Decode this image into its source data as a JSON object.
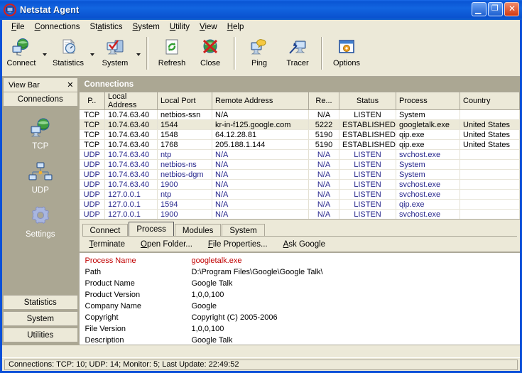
{
  "window": {
    "title": "Netstat Agent",
    "app_icon": "netstat-agent-icon",
    "minimize_glyph": "_",
    "maximize_glyph": "❐",
    "close_glyph": "✕"
  },
  "menu": [
    {
      "label": "File",
      "accel": "F"
    },
    {
      "label": "Connections",
      "accel": "C"
    },
    {
      "label": "Statistics",
      "accel": "a"
    },
    {
      "label": "System",
      "accel": "S"
    },
    {
      "label": "Utility",
      "accel": "U"
    },
    {
      "label": "View",
      "accel": "V"
    },
    {
      "label": "Help",
      "accel": "H"
    }
  ],
  "toolbar": [
    {
      "label": "Connect",
      "icon": "globe-connect-icon",
      "dropdown": true
    },
    {
      "label": "Statistics",
      "icon": "document-clock-icon",
      "dropdown": true
    },
    {
      "label": "System",
      "icon": "system-check-icon",
      "dropdown": true
    },
    {
      "label": "Refresh",
      "icon": "refresh-icon",
      "dropdown": false
    },
    {
      "label": "Close",
      "icon": "close-connection-icon",
      "dropdown": false
    },
    {
      "label": "Ping",
      "icon": "ping-icon",
      "dropdown": false
    },
    {
      "label": "Tracer",
      "icon": "tracer-icon",
      "dropdown": false
    },
    {
      "label": "Options",
      "icon": "options-icon",
      "dropdown": false
    }
  ],
  "viewbar": {
    "title": "View Bar",
    "close_glyph": "✕",
    "group_label": "Connections",
    "items": [
      {
        "label": "TCP",
        "icon": "tcp-globe-icon"
      },
      {
        "label": "UDP",
        "icon": "udp-network-icon"
      },
      {
        "label": "Settings",
        "icon": "gear-icon"
      }
    ],
    "buttons": [
      "Statistics",
      "System",
      "Utilities"
    ]
  },
  "connections": {
    "panel_title": "Connections",
    "columns": [
      "P..",
      "Local Address",
      "Local Port",
      "Remote Address",
      "Re...",
      "Status",
      "Process",
      "Country"
    ],
    "rows": [
      {
        "proto": "TCP",
        "local_address": "10.74.63.40",
        "local_port": "netbios-ssn",
        "remote_address": "N/A",
        "remote_port": "N/A",
        "status": "LISTEN",
        "process": "System",
        "country": "",
        "selected": false
      },
      {
        "proto": "TCP",
        "local_address": "10.74.63.40",
        "local_port": "1544",
        "remote_address": "kr-in-f125.google.com",
        "remote_port": "5222",
        "status": "ESTABLISHED",
        "process": "googletalk.exe",
        "country": "United States",
        "selected": true
      },
      {
        "proto": "TCP",
        "local_address": "10.74.63.40",
        "local_port": "1548",
        "remote_address": "64.12.28.81",
        "remote_port": "5190",
        "status": "ESTABLISHED",
        "process": "qip.exe",
        "country": "United States",
        "selected": false
      },
      {
        "proto": "TCP",
        "local_address": "10.74.63.40",
        "local_port": "1768",
        "remote_address": "205.188.1.144",
        "remote_port": "5190",
        "status": "ESTABLISHED",
        "process": "qip.exe",
        "country": "United States",
        "selected": false
      },
      {
        "proto": "UDP",
        "local_address": "10.74.63.40",
        "local_port": "ntp",
        "remote_address": "N/A",
        "remote_port": "N/A",
        "status": "LISTEN",
        "process": "svchost.exe",
        "country": "",
        "selected": false
      },
      {
        "proto": "UDP",
        "local_address": "10.74.63.40",
        "local_port": "netbios-ns",
        "remote_address": "N/A",
        "remote_port": "N/A",
        "status": "LISTEN",
        "process": "System",
        "country": "",
        "selected": false
      },
      {
        "proto": "UDP",
        "local_address": "10.74.63.40",
        "local_port": "netbios-dgm",
        "remote_address": "N/A",
        "remote_port": "N/A",
        "status": "LISTEN",
        "process": "System",
        "country": "",
        "selected": false
      },
      {
        "proto": "UDP",
        "local_address": "10.74.63.40",
        "local_port": "1900",
        "remote_address": "N/A",
        "remote_port": "N/A",
        "status": "LISTEN",
        "process": "svchost.exe",
        "country": "",
        "selected": false
      },
      {
        "proto": "UDP",
        "local_address": "127.0.0.1",
        "local_port": "ntp",
        "remote_address": "N/A",
        "remote_port": "N/A",
        "status": "LISTEN",
        "process": "svchost.exe",
        "country": "",
        "selected": false
      },
      {
        "proto": "UDP",
        "local_address": "127.0.0.1",
        "local_port": "1594",
        "remote_address": "N/A",
        "remote_port": "N/A",
        "status": "LISTEN",
        "process": "qip.exe",
        "country": "",
        "selected": false
      },
      {
        "proto": "UDP",
        "local_address": "127.0.0.1",
        "local_port": "1900",
        "remote_address": "N/A",
        "remote_port": "N/A",
        "status": "LISTEN",
        "process": "svchost.exe",
        "country": "",
        "selected": false
      }
    ]
  },
  "details": {
    "tabs": [
      {
        "label": "Connect",
        "active": false
      },
      {
        "label": "Process",
        "active": true
      },
      {
        "label": "Modules",
        "active": false
      },
      {
        "label": "System",
        "active": false
      }
    ],
    "actions": [
      {
        "label": "Terminate",
        "accel": "T"
      },
      {
        "label": "Open Folder...",
        "accel": "O"
      },
      {
        "label": "File Properties...",
        "accel": "F"
      },
      {
        "label": "Ask Google",
        "accel": "A"
      }
    ],
    "properties": [
      {
        "key": "Process Name",
        "value": "googletalk.exe"
      },
      {
        "key": "Path",
        "value": "D:\\Program Files\\Google\\Google Talk\\"
      },
      {
        "key": "Product Name",
        "value": "Google Talk"
      },
      {
        "key": "Product Version",
        "value": "1,0,0,100"
      },
      {
        "key": "Company Name",
        "value": "Google"
      },
      {
        "key": "Copyright",
        "value": "Copyright (C) 2005-2006"
      },
      {
        "key": "File Version",
        "value": "1,0,0,100"
      },
      {
        "key": "Description",
        "value": "Google Talk"
      }
    ]
  },
  "statusbar": {
    "text": "Connections: TCP: 10; UDP: 14; Monitor: 5; Last Update: 22:49:52"
  },
  "colors": {
    "titlebar_blue": "#0a55d4",
    "face": "#ece9d8",
    "viewbar_taupe": "#aba793",
    "udp_text": "#26268c",
    "highlight_red": "#c00000",
    "border": "#aca899"
  }
}
